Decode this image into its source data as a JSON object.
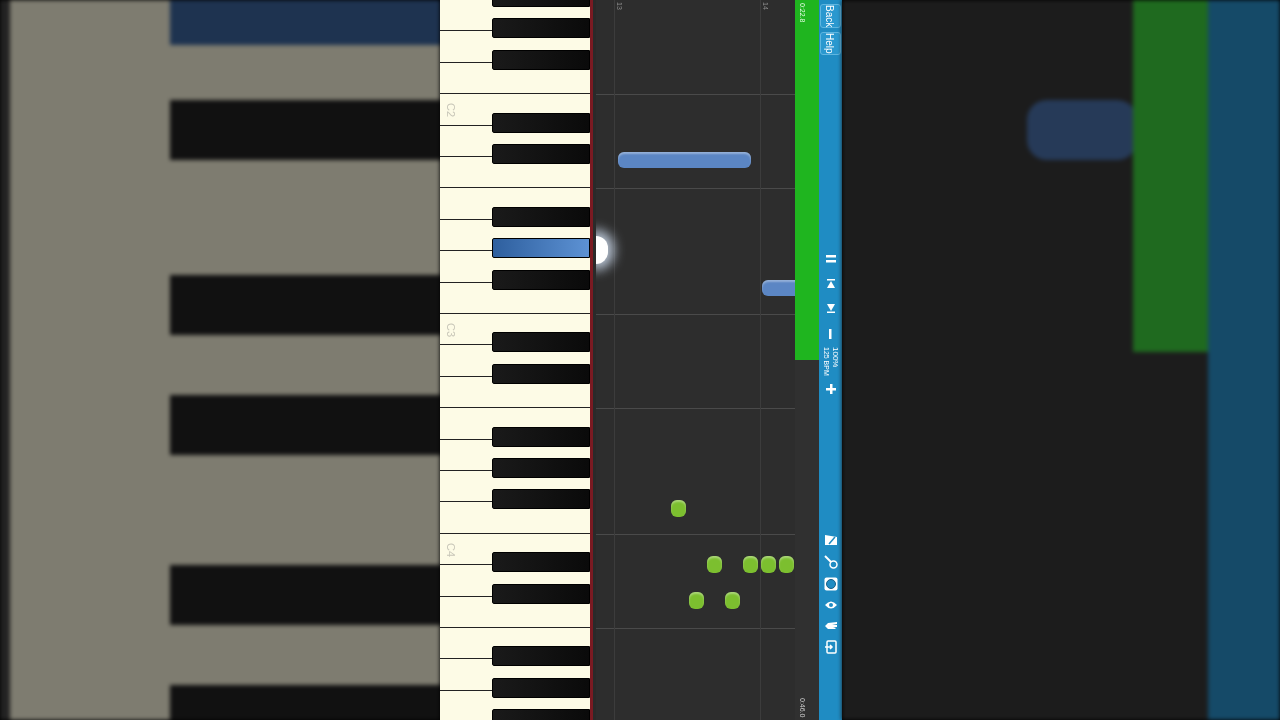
{
  "keyboard": {
    "keys": [
      {
        "kind": "sharp",
        "pressed": false
      },
      {
        "kind": "natural"
      },
      {
        "kind": "sharp",
        "pressed": false
      },
      {
        "kind": "natural"
      },
      {
        "kind": "sharp",
        "pressed": false
      },
      {
        "kind": "natural"
      },
      {
        "kind": "natural",
        "label": "C2"
      },
      {
        "kind": "sharp",
        "pressed": false
      },
      {
        "kind": "natural"
      },
      {
        "kind": "sharp",
        "pressed": false
      },
      {
        "kind": "natural"
      },
      {
        "kind": "natural"
      },
      {
        "kind": "sharp",
        "pressed": false
      },
      {
        "kind": "natural"
      },
      {
        "kind": "sharp",
        "pressed": true
      },
      {
        "kind": "natural"
      },
      {
        "kind": "sharp",
        "pressed": false
      },
      {
        "kind": "natural"
      },
      {
        "kind": "natural",
        "label": "C3"
      },
      {
        "kind": "sharp",
        "pressed": false
      },
      {
        "kind": "natural"
      },
      {
        "kind": "sharp",
        "pressed": false
      },
      {
        "kind": "natural"
      },
      {
        "kind": "natural"
      },
      {
        "kind": "sharp",
        "pressed": false
      },
      {
        "kind": "natural"
      },
      {
        "kind": "sharp",
        "pressed": false
      },
      {
        "kind": "natural"
      },
      {
        "kind": "sharp",
        "pressed": false
      },
      {
        "kind": "natural"
      },
      {
        "kind": "natural",
        "label": "C4"
      },
      {
        "kind": "sharp",
        "pressed": false
      },
      {
        "kind": "natural"
      },
      {
        "kind": "sharp",
        "pressed": false
      },
      {
        "kind": "natural"
      },
      {
        "kind": "natural"
      },
      {
        "kind": "sharp",
        "pressed": false
      },
      {
        "kind": "natural"
      },
      {
        "kind": "sharp",
        "pressed": false
      },
      {
        "kind": "natural"
      },
      {
        "kind": "sharp",
        "pressed": false
      },
      {
        "kind": "natural"
      }
    ]
  },
  "lane": {
    "measures": [
      {
        "label": "13"
      },
      {
        "label": "14"
      }
    ],
    "notes": [
      {
        "color": "#5b86c4"
      },
      {
        "color": "#5b86c4"
      },
      {
        "color": "#7cbf2f"
      },
      {
        "color": "#7cbf2f"
      },
      {
        "color": "#7cbf2f"
      },
      {
        "color": "#7cbf2f"
      },
      {
        "color": "#7cbf2f"
      },
      {
        "color": "#7cbf2f"
      },
      {
        "color": "#7cbf2f"
      }
    ]
  },
  "progress": {
    "level": 0.5,
    "elapsed": "0:22.8",
    "total": "0:46.0"
  },
  "sidebar": {
    "buttons": [
      {
        "label": "Back"
      },
      {
        "label": "Help"
      }
    ],
    "tempo": {
      "percent": "100%",
      "bpm": "125 BPM"
    }
  }
}
